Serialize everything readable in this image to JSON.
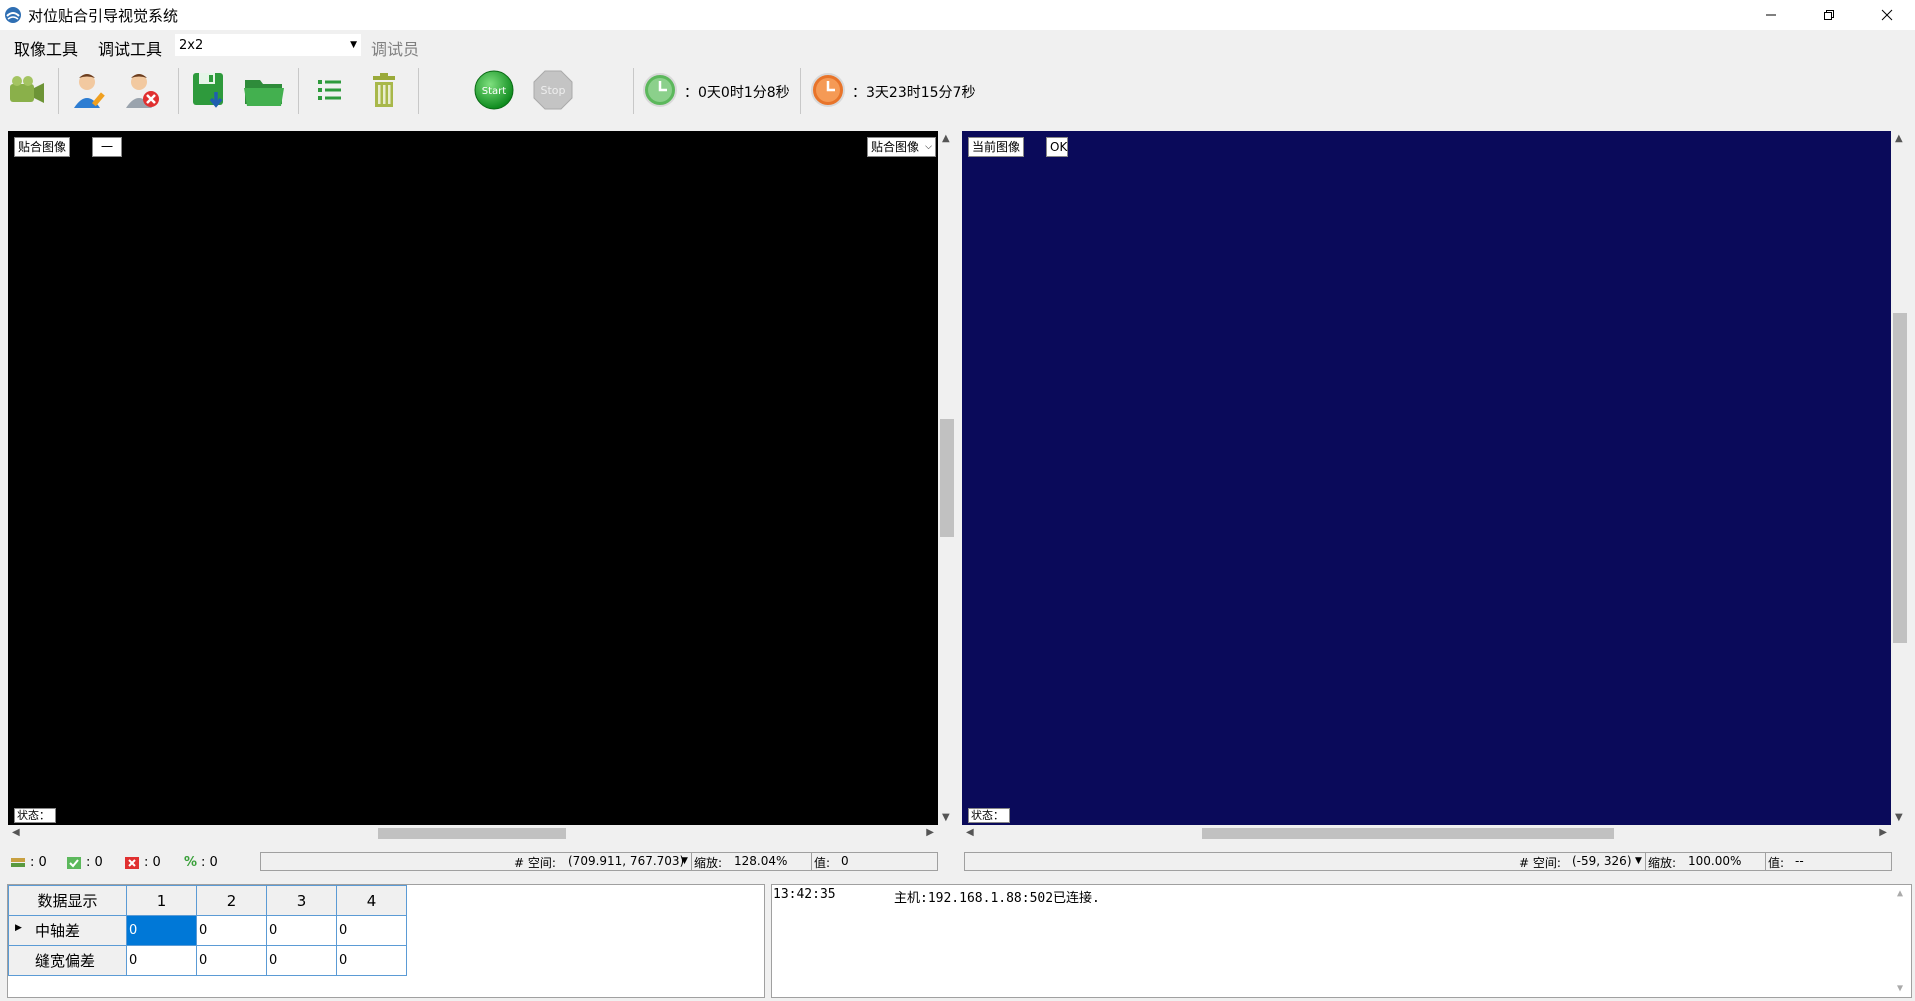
{
  "window": {
    "title": "对位贴合引导视觉系统"
  },
  "menu": {
    "capture_tools": "取像工具",
    "debug_tools": "调试工具",
    "layout_value": "2x2",
    "role": "调试员"
  },
  "toolbar": {
    "start_label": "Start",
    "stop_label": "Stop",
    "run_time": "：0天0时1分8秒",
    "total_time": "：3天23时15分7秒"
  },
  "left_panel": {
    "title": "贴合图像",
    "tag": "一",
    "view_select": "贴合图像",
    "status": "状态：",
    "background": "#000000"
  },
  "right_panel": {
    "title": "当前图像",
    "tag": "OK",
    "status": "状态：",
    "background": "#0a0a5a"
  },
  "counters": {
    "c1": ": 0",
    "c2": ": 0",
    "c3": ": 0",
    "c4": ": 0",
    "percent_symbol": "%"
  },
  "left_statusbar": {
    "space_label": "# 空间:",
    "coords": "(709.911, 767.703)",
    "zoom_label": "缩放:",
    "zoom": "128.04%",
    "value_label": "值:",
    "value": "0"
  },
  "right_statusbar": {
    "space_label": "# 空间:",
    "coords": "(-59, 326)",
    "zoom_label": "缩放:",
    "zoom": "100.00%",
    "value_label": "值:",
    "value": "--"
  },
  "grid": {
    "header": [
      "数据显示",
      "1",
      "2",
      "3",
      "4"
    ],
    "rows": [
      {
        "label": "中轴差",
        "values": [
          "0",
          "0",
          "0",
          "0"
        ]
      },
      {
        "label": "缝宽偏差",
        "values": [
          "0",
          "0",
          "0",
          "0"
        ]
      }
    ]
  },
  "log": {
    "time": "13:42:35",
    "message": "主机:192.168.1.88:502已连接."
  }
}
